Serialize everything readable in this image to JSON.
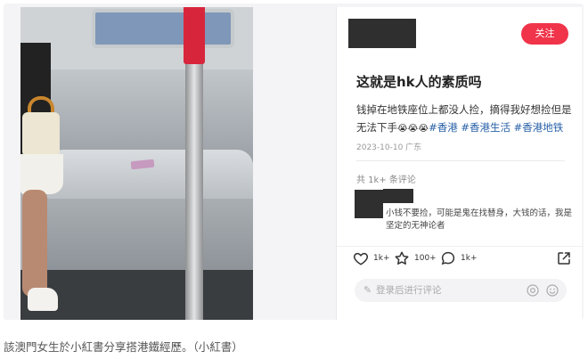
{
  "post": {
    "follow_label": "关注",
    "title": "这就是hk人的素质吗",
    "body_line1": "钱掉在地铁座位上都没人捡，摘得我好想捡但是",
    "body_line2_prefix": "无法下手",
    "body_emoji": "😭😭😭",
    "tags": [
      "#香港",
      "#香港生活",
      "#香港地铁"
    ],
    "date_location": "2023-10-10 广东",
    "comment_count_label": "共 1k+ 条评论"
  },
  "comment": {
    "text": "小钱不要捡，可能是鬼在找替身，大钱的话，我是坚定的无神论者"
  },
  "actions": {
    "like_count": "1k+",
    "collect_count": "100+",
    "comment_count": "1k+"
  },
  "comment_input": {
    "placeholder": "登录后进行评论"
  },
  "caption": {
    "text": "該澳門女生於小紅書分享搭港鐵經歷。（小紅書）"
  },
  "colors": {
    "follow_button": "#f0344a",
    "tag": "#2a62a8",
    "pole_red": "#d7263c"
  }
}
